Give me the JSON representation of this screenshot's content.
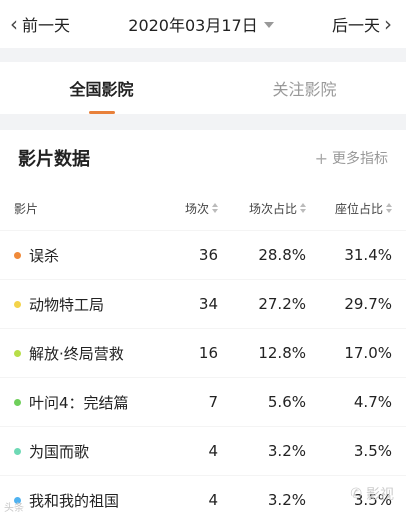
{
  "datebar": {
    "prev_label": "前一天",
    "date": "2020年03月17日",
    "next_label": "后一天"
  },
  "tabs": [
    {
      "label": "全国影院",
      "active": true
    },
    {
      "label": "关注影院",
      "active": false
    }
  ],
  "section": {
    "title": "影片数据",
    "more_label": "更多指标"
  },
  "table": {
    "headers": [
      "影片",
      "场次",
      "场次占比",
      "座位占比"
    ],
    "rows": [
      {
        "name": "误杀",
        "shows": "36",
        "show_ratio": "28.8%",
        "seat_ratio": "31.4%",
        "color": "#f08a3a"
      },
      {
        "name": "动物特工局",
        "shows": "34",
        "show_ratio": "27.2%",
        "seat_ratio": "29.7%",
        "color": "#f3d34a"
      },
      {
        "name": "解放·终局营救",
        "shows": "16",
        "show_ratio": "12.8%",
        "seat_ratio": "17.0%",
        "color": "#b7de48"
      },
      {
        "name": "叶问4：完结篇",
        "shows": "7",
        "show_ratio": "5.6%",
        "seat_ratio": "4.7%",
        "color": "#6fcf5b"
      },
      {
        "name": "为国而歌",
        "shows": "4",
        "show_ratio": "3.2%",
        "seat_ratio": "3.5%",
        "color": "#6ed9b5"
      },
      {
        "name": "我和我的祖国",
        "shows": "4",
        "show_ratio": "3.2%",
        "seat_ratio": "3.5%",
        "color": "#4fb2f0"
      }
    ]
  },
  "watermarks": {
    "left": "头条",
    "right": "影视"
  }
}
